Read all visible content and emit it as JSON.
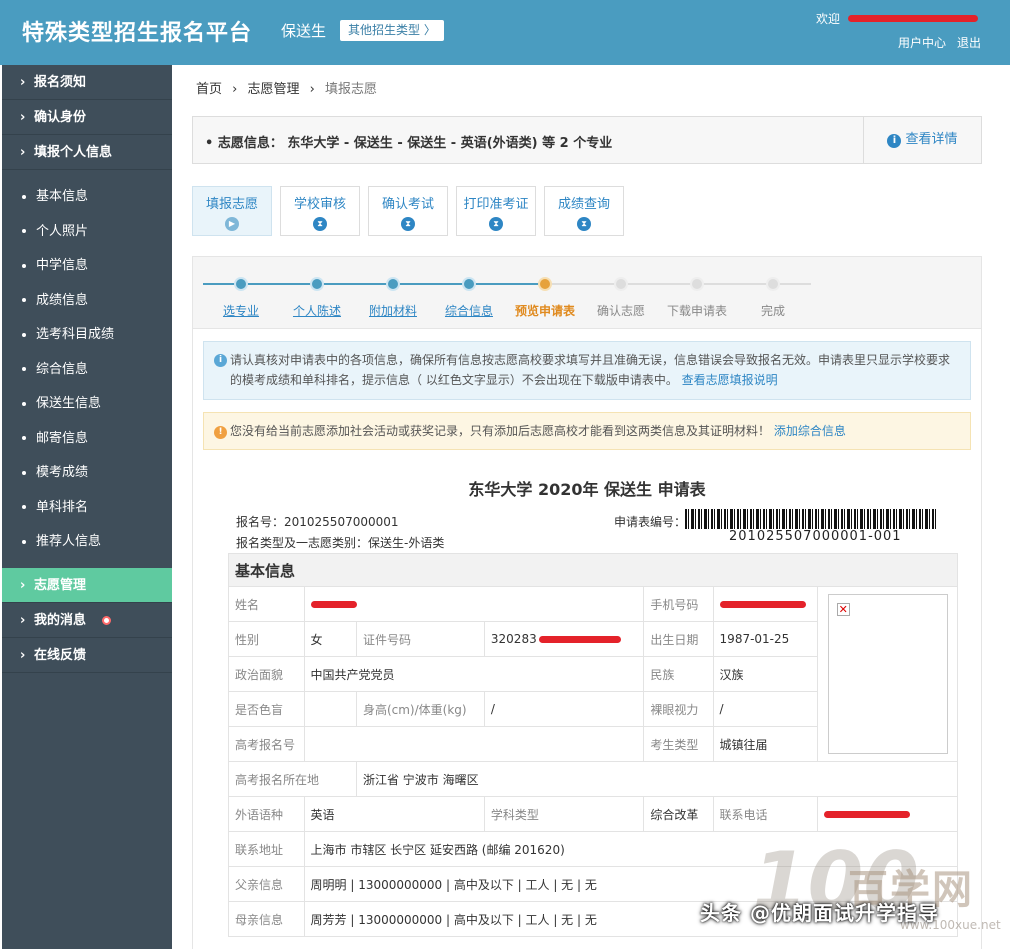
{
  "header": {
    "brand": "特殊类型招生报名平台",
    "sub": "保送生",
    "other_type": "其他招生类型 〉",
    "welcome": "欢迎",
    "user_center": "用户中心",
    "logout": "退出"
  },
  "sidebar": {
    "top_items": [
      {
        "label": "报名须知"
      },
      {
        "label": "确认身份"
      },
      {
        "label": "填报个人信息"
      }
    ],
    "sub_items": [
      {
        "label": "基本信息"
      },
      {
        "label": "个人照片"
      },
      {
        "label": "中学信息"
      },
      {
        "label": "成绩信息"
      },
      {
        "label": "选考科目成绩"
      },
      {
        "label": "综合信息"
      },
      {
        "label": "保送生信息"
      },
      {
        "label": "邮寄信息"
      },
      {
        "label": "模考成绩"
      },
      {
        "label": "单科排名"
      },
      {
        "label": "推荐人信息"
      }
    ],
    "bottom_items": [
      {
        "label": "志愿管理"
      },
      {
        "label": "我的消息"
      },
      {
        "label": "在线反馈"
      }
    ]
  },
  "breadcrumb": {
    "home": "首页",
    "mid": "志愿管理",
    "current": "填报志愿"
  },
  "info_bar": {
    "text": "•  志愿信息：  东华大学 - 保送生 - 保送生 - 英语(外语类) 等 2 个专业",
    "detail": "查看详情"
  },
  "tabs": [
    {
      "label": "填报志愿"
    },
    {
      "label": "学校审核"
    },
    {
      "label": "确认考试"
    },
    {
      "label": "打印准考证"
    },
    {
      "label": "成绩查询"
    }
  ],
  "progress": [
    {
      "label": "选专业"
    },
    {
      "label": "个人陈述"
    },
    {
      "label": "附加材料"
    },
    {
      "label": "综合信息"
    },
    {
      "label": "预览申请表"
    },
    {
      "label": "确认志愿"
    },
    {
      "label": "下载申请表"
    },
    {
      "label": "完成"
    }
  ],
  "notice_blue": {
    "text": "请认真核对申请表中的各项信息，确保所有信息按志愿高校要求填写并且准确无误，信息错误会导致报名无效。申请表里只显示学校要求的模考成绩和单科排名，提示信息（ 以红色文字显示）不会出现在下载版申请表中。",
    "link": "查看志愿填报说明"
  },
  "notice_yellow": {
    "text": "您没有给当前志愿添加社会活动或获奖记录，只有添加后志愿高校才能看到这两类信息及其证明材料！",
    "link": "添加综合信息"
  },
  "form": {
    "title": "东华大学 2020年 保送生 申请表",
    "reg_no": "报名号：201025507000001",
    "type_line": "报名类型及一志愿类别：保送生-外语类",
    "app_no_label": "申请表编号：",
    "app_no": "201025507000001-001",
    "section": "基本信息",
    "rows": {
      "name_lbl": "姓名",
      "phone_lbl": "手机号码",
      "gender_lbl": "性别",
      "gender": "女",
      "id_lbl": "证件号码",
      "id_val": "320283",
      "birth_lbl": "出生日期",
      "birth": "1987-01-25",
      "politics_lbl": "政治面貌",
      "politics": "中国共产党党员",
      "ethnic_lbl": "民族",
      "ethnic": "汉族",
      "colorblind_lbl": "是否色盲",
      "hw_lbl": "身高(cm)/体重(kg)",
      "hw": "/",
      "vision_lbl": "裸眼视力",
      "vision": "/",
      "gk_no_lbl": "高考报名号",
      "stu_type_lbl": "考生类型",
      "stu_type": "城镇往届",
      "gk_loc_lbl": "高考报名所在地",
      "gk_loc": "浙江省 宁波市 海曙区",
      "lang_lbl": "外语语种",
      "lang": "英语",
      "subj_lbl": "学科类型",
      "reform_lbl": "综合改革",
      "tel_lbl": "联系电话",
      "addr_lbl": "联系地址",
      "addr": "上海市 市辖区 长宁区 延安西路 (邮编 201620)",
      "father_lbl": "父亲信息",
      "father": "周明明 | 13000000000 | 高中及以下 | 工人 | 无 | 无",
      "mother_lbl": "母亲信息",
      "mother": "周芳芳 | 13000000000 | 高中及以下 | 工人 | 无 | 无"
    }
  },
  "watermark": {
    "caption": "头条 @优朗面试升学指导",
    "big": "百学网",
    "num": "100",
    "url": "www.100xue.net"
  },
  "colors": {
    "header": "#4a9cc0",
    "sidebar": "#3f4e5a",
    "active": "#5fcaa0",
    "link": "#2e86c4",
    "done": "#4a9cc0",
    "current": "#e6a23c",
    "redact": "#e4222a"
  }
}
